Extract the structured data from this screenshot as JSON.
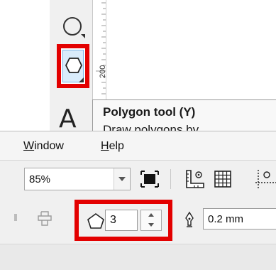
{
  "toolbox": {
    "tools": [
      {
        "name": "ellipse",
        "icon": "ellipse-tool-icon"
      },
      {
        "name": "polygon",
        "icon": "polygon-tool-icon",
        "highlighted": true
      },
      {
        "name": "text",
        "icon": "text-tool-icon",
        "glyph": "A"
      }
    ]
  },
  "ruler": {
    "label": "200"
  },
  "tooltip": {
    "title": "Polygon tool (Y)",
    "description": "Draw polygons by"
  },
  "menubar": {
    "items": [
      {
        "label_prefix": "",
        "label_underlined": "W",
        "label_rest": "indow"
      },
      {
        "label_prefix": "",
        "label_underlined": "H",
        "label_rest": "elp"
      }
    ]
  },
  "toolbar": {
    "zoom": {
      "value": "85%"
    },
    "icons": [
      "fit-page-icon",
      "rulers-icon",
      "grid-icon",
      "guidelines-icon"
    ]
  },
  "property_bar": {
    "sides": {
      "value": "3",
      "icon": "polygon-icon"
    },
    "outline_width": {
      "value": "0.2 mm",
      "icon": "pen-nib-icon"
    }
  },
  "colors": {
    "highlight": "#e30000",
    "selected_tool_bg": "#d9ecfb"
  }
}
